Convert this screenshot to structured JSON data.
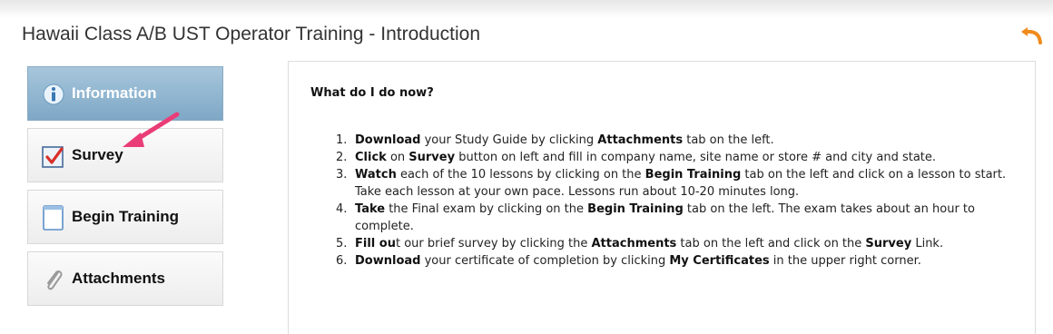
{
  "page": {
    "title": "Hawaii Class A/B UST Operator Training - Introduction"
  },
  "icons": {
    "back": "undo-arrow-icon",
    "arrow": "pink-pointer-arrow"
  },
  "colors": {
    "accent": "#f08a1c",
    "active_tab": "#8db3ce",
    "pointer": "#ea3d78"
  },
  "sidebar": {
    "items": [
      {
        "label": "Information",
        "icon": "info-icon",
        "active": true
      },
      {
        "label": "Survey",
        "icon": "checkbox-icon",
        "active": false
      },
      {
        "label": "Begin Training",
        "icon": "notebook-icon",
        "active": false
      },
      {
        "label": "Attachments",
        "icon": "paperclip-icon",
        "active": false
      }
    ]
  },
  "content": {
    "heading": "What do I do now?",
    "steps": [
      {
        "n": "1.",
        "parts": [
          {
            "t": "Download",
            "b": true
          },
          {
            "t": " your Study Guide by clicking "
          },
          {
            "t": "Attachments",
            "b": true
          },
          {
            "t": " tab on the left."
          }
        ]
      },
      {
        "n": "2.",
        "parts": [
          {
            "t": "Click",
            "b": true
          },
          {
            "t": " on "
          },
          {
            "t": "Survey",
            "b": true
          },
          {
            "t": " button on left and fill in company name, site name or store # and city and state."
          }
        ]
      },
      {
        "n": "3.",
        "parts": [
          {
            "t": "Watch",
            "b": true
          },
          {
            "t": " each of the 10 lessons by clicking on the "
          },
          {
            "t": "Begin Training",
            "b": true
          },
          {
            "t": " tab on the left and click on a lesson to start. Take each lesson at your own pace. Lessons run about 10-20 minutes long."
          }
        ]
      },
      {
        "n": "4.",
        "parts": [
          {
            "t": "Take",
            "b": true
          },
          {
            "t": " the Final exam by clicking on the "
          },
          {
            "t": "Begin Training",
            "b": true
          },
          {
            "t": " tab on the left. The exam takes about an hour to complete."
          }
        ]
      },
      {
        "n": "5.",
        "parts": [
          {
            "t": "Fill ou",
            "b": true
          },
          {
            "t": "t our brief survey by clicking the "
          },
          {
            "t": "Attachments",
            "b": true
          },
          {
            "t": " tab on the left and click on the "
          },
          {
            "t": "Survey",
            "b": true
          },
          {
            "t": " Link."
          }
        ]
      },
      {
        "n": "6.",
        "parts": [
          {
            "t": "Download",
            "b": true
          },
          {
            "t": " your certificate of completion by clicking "
          },
          {
            "t": "My Certificates",
            "b": true
          },
          {
            "t": " in the upper right corner."
          }
        ]
      }
    ]
  }
}
